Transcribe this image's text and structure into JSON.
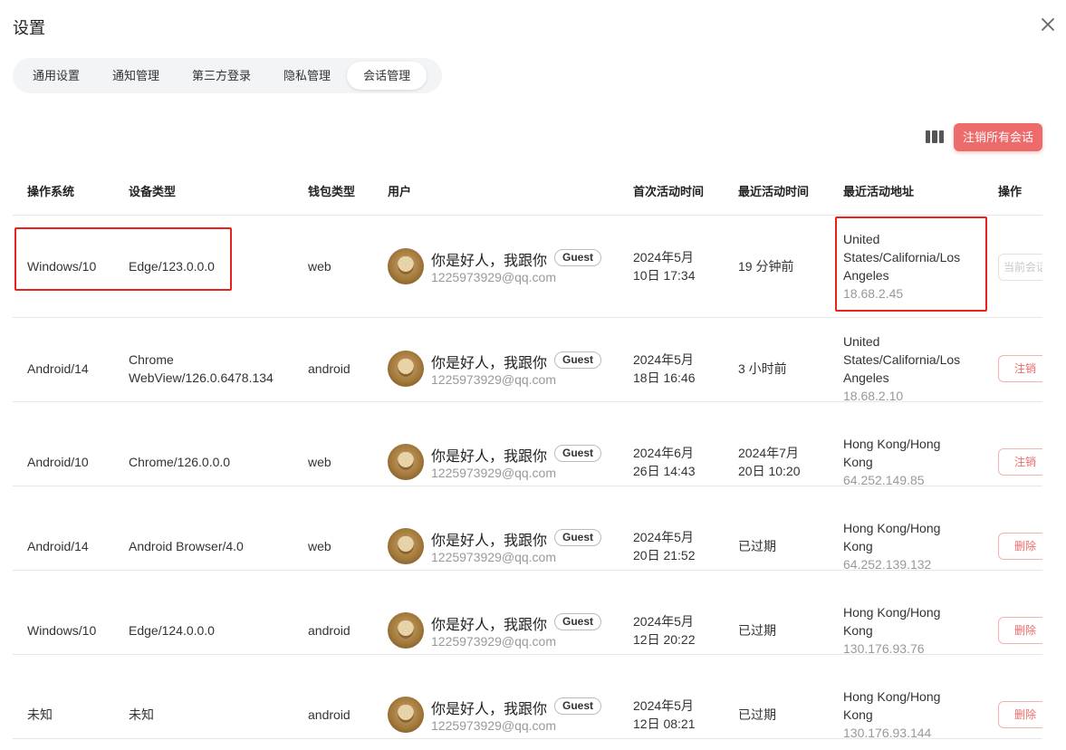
{
  "dialog": {
    "title": "设置",
    "close_icon": "close-icon"
  },
  "tabs": [
    {
      "label": "通用设置"
    },
    {
      "label": "通知管理"
    },
    {
      "label": "第三方登录"
    },
    {
      "label": "隐私管理"
    },
    {
      "label": "会话管理",
      "active": true
    }
  ],
  "toolbar": {
    "columns_icon": "columns-icon",
    "logout_all_label": "注销所有会话",
    "accent_color": "#ed6b6b"
  },
  "table": {
    "headers": {
      "os": "操作系统",
      "device": "设备类型",
      "wallet": "钱包类型",
      "user": "用户",
      "first_active": "首次活动时间",
      "last_active": "最近活动时间",
      "last_address": "最近活动地址",
      "action": "操作"
    },
    "rows": [
      {
        "os": "Windows/10",
        "device": "Edge/123.0.0.0",
        "wallet": "web",
        "user_name": "你是好人，我跟你",
        "user_badge": "Guest",
        "user_email": "1225973929@qq.com",
        "first_active_1": "2024年5月",
        "first_active_2": "10日 17:34",
        "last_active_1": "19 分钟前",
        "last_active_2": "",
        "addr_1": "United",
        "addr_2": "States/California/Los",
        "addr_3": "Angeles",
        "ip": "18.68.2.45",
        "action": "当前会话"
      },
      {
        "os": "Android/14",
        "device_1": "Chrome",
        "device_2": "WebView/126.0.6478.134",
        "wallet": "android",
        "user_name": "你是好人，我跟你",
        "user_badge": "Guest",
        "user_email": "1225973929@qq.com",
        "first_active_1": "2024年5月",
        "first_active_2": "18日 16:46",
        "last_active_1": "3 小时前",
        "last_active_2": "",
        "addr_1": "United",
        "addr_2": "States/California/Los",
        "addr_3": "Angeles",
        "ip": "18.68.2.10",
        "action": "注销"
      },
      {
        "os": "Android/10",
        "device": "Chrome/126.0.0.0",
        "wallet": "web",
        "user_name": "你是好人，我跟你",
        "user_badge": "Guest",
        "user_email": "1225973929@qq.com",
        "first_active_1": "2024年6月",
        "first_active_2": "26日 14:43",
        "last_active_1": "2024年7月",
        "last_active_2": "20日 10:20",
        "addr_1": "Hong Kong/Hong",
        "addr_2": "Kong",
        "ip": "64.252.149.85",
        "action": "注销"
      },
      {
        "os": "Android/14",
        "device": "Android Browser/4.0",
        "wallet": "web",
        "user_name": "你是好人，我跟你",
        "user_badge": "Guest",
        "user_email": "1225973929@qq.com",
        "first_active_1": "2024年5月",
        "first_active_2": "20日 21:52",
        "last_active_1": "已过期",
        "last_active_2": "",
        "addr_1": "Hong Kong/Hong",
        "addr_2": "Kong",
        "ip": "64.252.139.132",
        "action": "删除"
      },
      {
        "os": "Windows/10",
        "device": "Edge/124.0.0.0",
        "wallet": "android",
        "user_name": "你是好人，我跟你",
        "user_badge": "Guest",
        "user_email": "1225973929@qq.com",
        "first_active_1": "2024年5月",
        "first_active_2": "12日 20:22",
        "last_active_1": "已过期",
        "last_active_2": "",
        "addr_1": "Hong Kong/Hong",
        "addr_2": "Kong",
        "ip": "130.176.93.76",
        "action": "删除"
      },
      {
        "os": "未知",
        "device": "未知",
        "wallet": "android",
        "user_name": "你是好人，我跟你",
        "user_badge": "Guest",
        "user_email": "1225973929@qq.com",
        "first_active_1": "2024年5月",
        "first_active_2": "12日 08:21",
        "last_active_1": "已过期",
        "last_active_2": "",
        "addr_1": "Hong Kong/Hong",
        "addr_2": "Kong",
        "ip": "130.176.93.144",
        "action": "删除"
      }
    ]
  },
  "annotation_color": "#e8231f"
}
